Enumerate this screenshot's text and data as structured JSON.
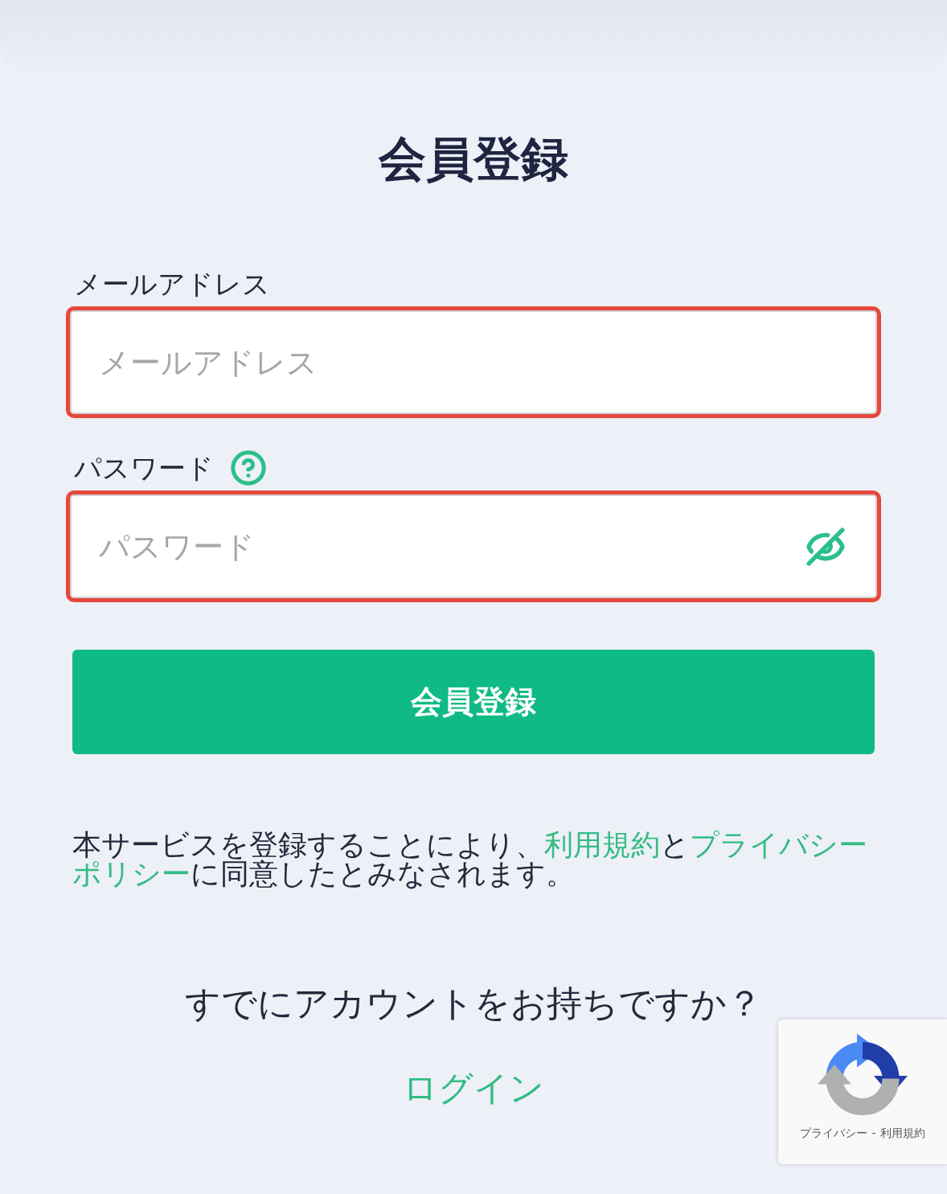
{
  "title": "会員登録",
  "form": {
    "fields": [
      {
        "label": "メールアドレス",
        "placeholder": "メールアドレス",
        "invalid": true
      },
      {
        "label": "パスワード",
        "placeholder": "パスワード",
        "invalid": true,
        "help": true,
        "reveal": false
      }
    ],
    "submit": "会員登録"
  },
  "terms": {
    "lines": [
      [
        {
          "kind": "text",
          "text": "本サービスを登録することにより、"
        },
        {
          "kind": "link",
          "text": "利用規約"
        },
        {
          "kind": "text",
          "text": "と"
        },
        {
          "kind": "link",
          "text": "プライバシー"
        }
      ],
      [
        {
          "kind": "link",
          "text": "ポリシー"
        },
        {
          "kind": "text",
          "text": "に同意したとみなされます。"
        }
      ]
    ]
  },
  "login": {
    "prompt": "すでにアカウントをお持ちですか？",
    "link": "ログイン"
  },
  "captcha": {
    "privacy": "プライバシー",
    "separator": "-",
    "terms": "利用規約"
  }
}
